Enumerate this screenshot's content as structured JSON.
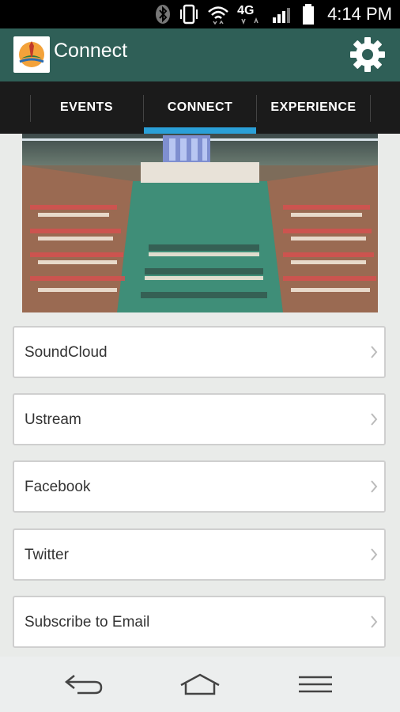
{
  "status_bar": {
    "time": "4:14 PM",
    "network_label": "4G",
    "icons": [
      "bluetooth-icon",
      "vibrate-icon",
      "wifi-icon",
      "lte-icon",
      "signal-icon",
      "battery-icon"
    ]
  },
  "app_bar": {
    "title": "Connect",
    "logo_icon": "church-logo-icon",
    "settings_icon": "gear-icon"
  },
  "tabs": [
    {
      "label": "EVENTS",
      "selected": false
    },
    {
      "label": "CONNECT",
      "selected": true
    },
    {
      "label": "EXPERIENCE",
      "selected": false
    }
  ],
  "hero": {
    "image": "church-sanctuary-photo"
  },
  "links": [
    {
      "label": "SoundCloud"
    },
    {
      "label": "Ustream"
    },
    {
      "label": "Facebook"
    },
    {
      "label": "Twitter"
    },
    {
      "label": "Subscribe to Email"
    }
  ],
  "nav": {
    "icons": [
      "back-icon",
      "home-icon",
      "menu-icon"
    ]
  },
  "colors": {
    "app_bar": "#2f5f57",
    "tab_bar": "#1b1b1b",
    "tab_indicator": "#2aa0d8",
    "background": "#e9ebe9"
  }
}
